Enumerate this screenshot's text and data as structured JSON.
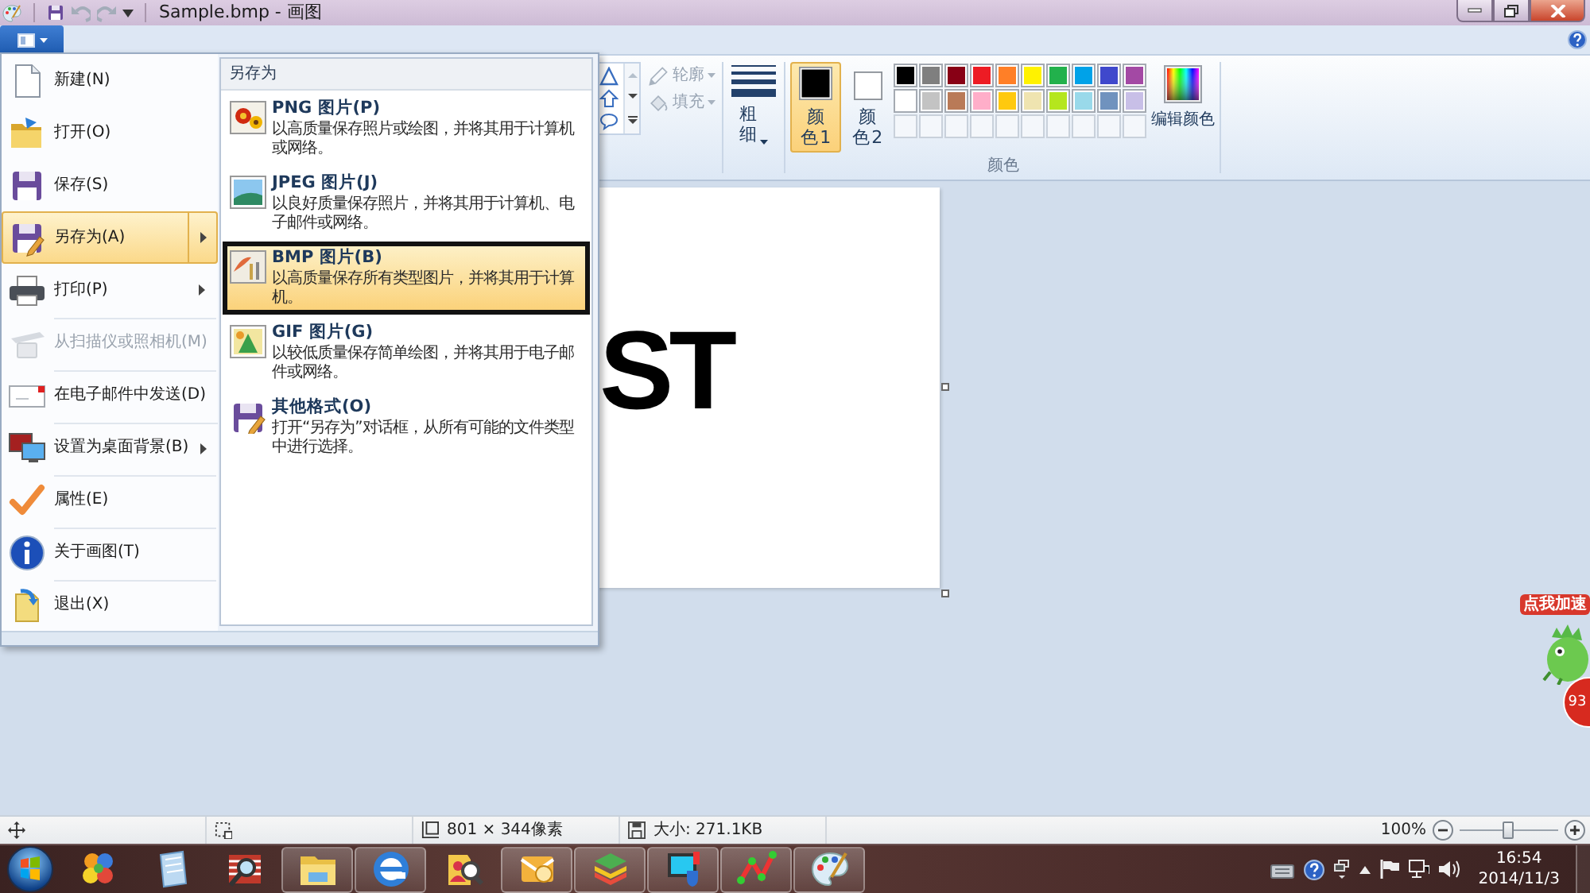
{
  "window": {
    "title": "Sample.bmp - 画图"
  },
  "quick_access": [
    {
      "kind": "save",
      "disabled": false
    },
    {
      "kind": "undo",
      "disabled": true
    },
    {
      "kind": "redo",
      "disabled": true
    }
  ],
  "ribbon": {
    "outline": {
      "label": "轮廓",
      "disabled": true
    },
    "fill": {
      "label": "填充",
      "disabled": true
    },
    "size": {
      "label": "粗细"
    },
    "color_slots": [
      {
        "label": "颜色 1",
        "color": "#000000",
        "selected": true
      },
      {
        "label": "颜色 2",
        "color": "#ffffff",
        "selected": false
      }
    ],
    "palette": [
      {
        "kind": "swatch",
        "color": "#000000"
      },
      {
        "kind": "swatch",
        "color": "#7f7f7f"
      },
      {
        "kind": "swatch",
        "color": "#880015"
      },
      {
        "kind": "swatch",
        "color": "#ed1c24"
      },
      {
        "kind": "swatch",
        "color": "#ff7f27"
      },
      {
        "kind": "swatch",
        "color": "#fff200"
      },
      {
        "kind": "swatch",
        "color": "#22b14c"
      },
      {
        "kind": "swatch",
        "color": "#00a2e8"
      },
      {
        "kind": "swatch",
        "color": "#3f48cc"
      },
      {
        "kind": "swatch",
        "color": "#a349a4"
      },
      {
        "kind": "swatch",
        "color": "#ffffff"
      },
      {
        "kind": "swatch",
        "color": "#c3c3c3"
      },
      {
        "kind": "swatch",
        "color": "#b97a57"
      },
      {
        "kind": "swatch",
        "color": "#ffaec9"
      },
      {
        "kind": "swatch",
        "color": "#ffc90e"
      },
      {
        "kind": "swatch",
        "color": "#efe4b0"
      },
      {
        "kind": "swatch",
        "color": "#b5e61d"
      },
      {
        "kind": "swatch",
        "color": "#99d9ea"
      },
      {
        "kind": "swatch",
        "color": "#7092be"
      },
      {
        "kind": "swatch",
        "color": "#c8bfe7"
      },
      {
        "kind": "empty"
      },
      {
        "kind": "empty"
      },
      {
        "kind": "empty"
      },
      {
        "kind": "empty"
      },
      {
        "kind": "empty"
      },
      {
        "kind": "empty"
      },
      {
        "kind": "empty"
      },
      {
        "kind": "empty"
      },
      {
        "kind": "empty"
      },
      {
        "kind": "empty"
      }
    ],
    "edit_colors": {
      "label": "编辑颜色"
    },
    "group_label": "颜色"
  },
  "file_menu": {
    "items": [
      {
        "kind": "new",
        "label": "新建(N)",
        "selected": false,
        "disabled": false,
        "submenu": false,
        "divider_above": false
      },
      {
        "kind": "open",
        "label": "打开(O)",
        "selected": false,
        "disabled": false,
        "submenu": false,
        "divider_above": false
      },
      {
        "kind": "save",
        "label": "保存(S)",
        "selected": false,
        "disabled": false,
        "submenu": false,
        "divider_above": false
      },
      {
        "kind": "save_as",
        "label": "另存为(A)",
        "selected": true,
        "disabled": false,
        "submenu": true,
        "divider_above": false
      },
      {
        "kind": "print",
        "label": "打印(P)",
        "selected": false,
        "disabled": false,
        "submenu": true,
        "divider_above": false
      },
      {
        "kind": "scanner",
        "label": "从扫描仪或照相机(M)",
        "selected": false,
        "disabled": true,
        "submenu": false,
        "divider_above": true
      },
      {
        "kind": "email",
        "label": "在电子邮件中发送(D)",
        "selected": false,
        "disabled": false,
        "submenu": false,
        "divider_above": true
      },
      {
        "kind": "desktop",
        "label": "设置为桌面背景(B)",
        "selected": false,
        "disabled": false,
        "submenu": true,
        "divider_above": true
      },
      {
        "kind": "properties",
        "label": "属性(E)",
        "selected": false,
        "disabled": false,
        "submenu": false,
        "divider_above": true
      },
      {
        "kind": "about",
        "label": "关于画图(T)",
        "selected": false,
        "disabled": false,
        "submenu": false,
        "divider_above": true
      },
      {
        "kind": "exit",
        "label": "退出(X)",
        "selected": false,
        "disabled": false,
        "submenu": false,
        "divider_above": true
      }
    ],
    "submenu": {
      "title": "另存为",
      "items": [
        {
          "kind": "png",
          "title": "PNG 图片(P)",
          "description": "以高质量保存照片或绘图，并将其用于计算机或网络。",
          "selected": false
        },
        {
          "kind": "jpeg",
          "title": "JPEG 图片(J)",
          "description": "以良好质量保存照片，并将其用于计算机、电子邮件或网络。",
          "selected": false
        },
        {
          "kind": "bmp",
          "title": "BMP 图片(B)",
          "description": "以高质量保存所有类型图片，并将其用于计算机。",
          "selected": true
        },
        {
          "kind": "gif",
          "title": "GIF 图片(G)",
          "description": "以较低质量保存简单绘图，并将其用于电子邮件或网络。",
          "selected": false
        },
        {
          "kind": "other",
          "title": "其他格式(O)",
          "description": "打开“另存为”对话框，从所有可能的文件类型中进行选择。",
          "selected": false
        }
      ]
    }
  },
  "canvas": {
    "text": "ST"
  },
  "widget": {
    "label": "点我加速",
    "badge": "93"
  },
  "status_bar": {
    "dimensions": "801 × 344像素",
    "file_size": "大小: 271.1KB",
    "zoom": {
      "reading": "100%",
      "level": 0.5
    }
  },
  "taskbar": {
    "items": [
      {
        "kind": "circles",
        "running": false
      },
      {
        "kind": "notepad",
        "running": false
      },
      {
        "kind": "magnifier",
        "running": false
      },
      {
        "kind": "folder",
        "running": true
      },
      {
        "kind": "browser",
        "running": true
      },
      {
        "kind": "user_search",
        "running": false
      },
      {
        "kind": "mail",
        "running": true
      },
      {
        "kind": "layers",
        "running": true
      },
      {
        "kind": "monitor",
        "running": true
      },
      {
        "kind": "network",
        "running": true
      },
      {
        "kind": "paint",
        "running": true
      }
    ],
    "clock": {
      "time": "16:54",
      "date": "2014/11/3"
    }
  }
}
